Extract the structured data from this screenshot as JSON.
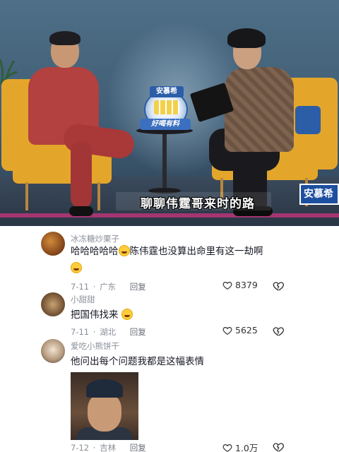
{
  "video": {
    "logo_top": "安慕希",
    "logo_bottom": "好喝有料",
    "subtitle": "聊聊伟霆哥来时的路",
    "name_tag": "安慕希"
  },
  "comments": [
    {
      "username": "冰冻糖炒栗子",
      "text_line1": "哈哈哈哈哈",
      "text_line1b": "陈伟霆也没算出命里有这一劫啊",
      "date": "7-11",
      "location": "广东",
      "reply": "回复",
      "likes": "8379"
    },
    {
      "username": "小甜甜",
      "text": "把国伟找来",
      "date": "7-11",
      "location": "湖北",
      "reply": "回复",
      "likes": "5625"
    },
    {
      "username": "爱吃小熊饼干",
      "text": "他问出每个问题我都是这幅表情",
      "date": "7-12",
      "location": "吉林",
      "reply": "回复",
      "likes": "1.0万"
    }
  ],
  "icons": {
    "like": "heart-icon",
    "dislike": "broken-heart-icon",
    "emoji_laugh": "laugh-cry-emoji",
    "emoji_think": "thinking-emoji"
  }
}
